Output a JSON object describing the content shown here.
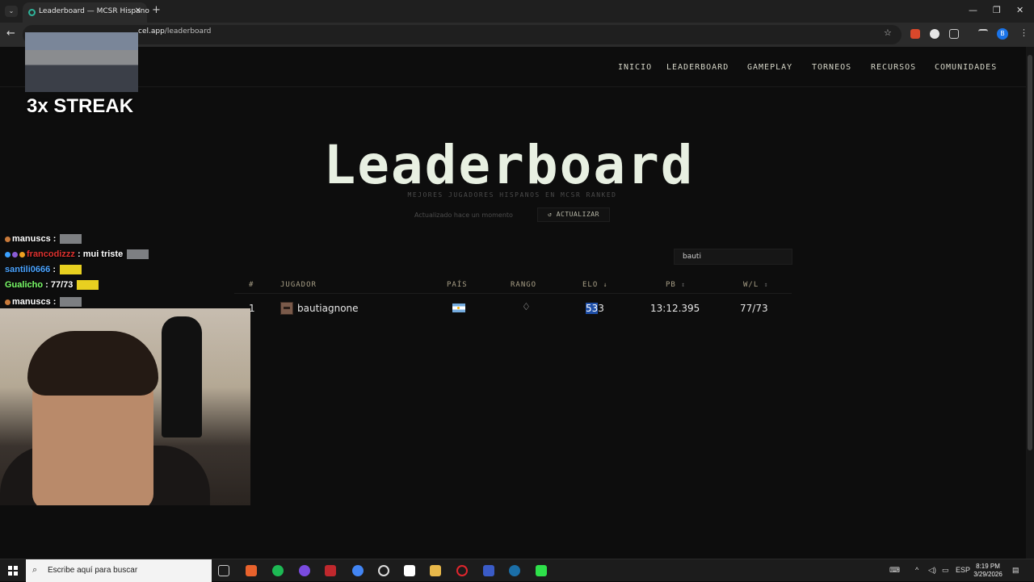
{
  "browser": {
    "tab_title": "Leaderboard — MCSR Hispano",
    "tab_close": "✕",
    "new_tab": "+",
    "url_host": "cel.app",
    "url_path": "/leaderboard",
    "profile_initial": "B",
    "win_min": "—",
    "win_restore": "❐",
    "win_close": "✕"
  },
  "nav": {
    "items": [
      "INICIO",
      "LEADERBOARD",
      "GAMEPLAY",
      "TORNEOS",
      "RECURSOS",
      "COMUNIDADES"
    ]
  },
  "header": {
    "title": "Leaderboard",
    "subtitle": "MEJORES JUGADORES HISPANOS EN MCSR RANKED",
    "updated": "Actualizado hace un momento",
    "refresh_label": "↺ ACTUALIZAR"
  },
  "search": {
    "value": "bauti"
  },
  "table": {
    "headers": {
      "rank": "#",
      "player": "JUGADOR",
      "country": "PAÍS",
      "tier": "RANGO",
      "elo": "ELO",
      "pb": "PB",
      "wl": "W/L"
    },
    "sort_active": "↓",
    "sort_inactive": "↕",
    "rows": [
      {
        "rank": "1",
        "player": "bautiagnone",
        "country_flag": "argentina",
        "tier_icon": "diamond-icon",
        "elo_selected": "53",
        "elo_rest": "3",
        "pb": "13:12.395",
        "wl": "77/73"
      }
    ]
  },
  "overlay": {
    "streak": "3x STREAK",
    "chat": [
      {
        "user": "manuscs",
        "user_color": "#ffffff",
        "message": ""
      },
      {
        "user": "francodizzz",
        "user_color": "#e0322f",
        "message": "mui triste"
      },
      {
        "user": "santili0666",
        "user_color": "#4aa3ff",
        "message": ""
      },
      {
        "user": "Gualicho",
        "user_color": "#7cff6a",
        "message": "77/73"
      },
      {
        "user": "manuscs",
        "user_color": "#ffffff",
        "message": ""
      }
    ]
  },
  "taskbar": {
    "search_placeholder": "Escribe aquí para buscar",
    "lang": "ESP",
    "time": "8:19 PM",
    "date": "3/29/2026"
  },
  "colors": {
    "page_bg": "#0d0d0d",
    "title": "#e8f0e2",
    "header_text": "#a89f86",
    "selection": "#1e4fa8"
  }
}
